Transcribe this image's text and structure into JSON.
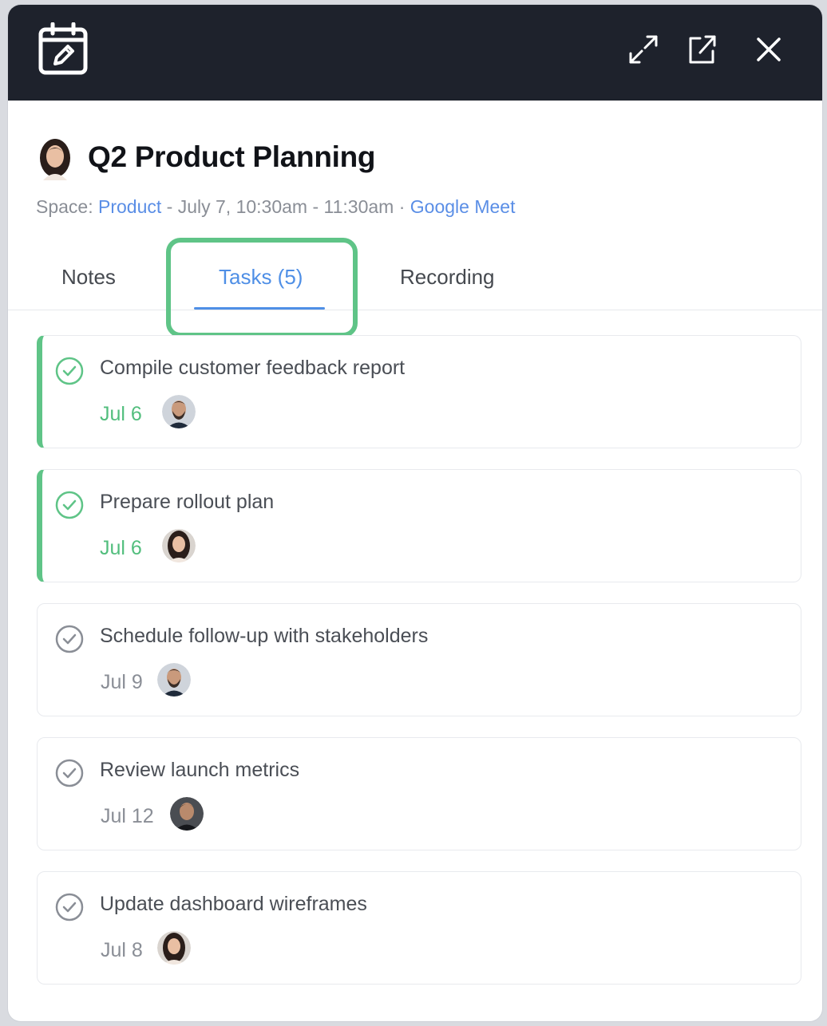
{
  "window": {
    "title": "Q2 Product Planning",
    "icons": {
      "app": "calendar-edit-icon",
      "expand": "expand-icon",
      "open": "open-external-icon",
      "close": "close-icon"
    }
  },
  "meta": {
    "space_label": "Space: ",
    "space_name": "Product",
    "time_text": " - July 7, 10:30am - 11:30am · ",
    "location": "Google Meet"
  },
  "tabs": [
    {
      "label": "Notes",
      "active": false
    },
    {
      "label": "Tasks (5)",
      "active": true
    },
    {
      "label": "Recording",
      "active": false
    }
  ],
  "tasks": [
    {
      "title": "Compile customer feedback report",
      "date": "Jul 6",
      "completed": true,
      "assignee": "man-beard"
    },
    {
      "title": "Prepare rollout plan",
      "date": "Jul 6",
      "completed": true,
      "assignee": "woman"
    },
    {
      "title": "Schedule follow-up with stakeholders",
      "date": "Jul 9",
      "completed": false,
      "assignee": "man-beard"
    },
    {
      "title": "Review launch metrics",
      "date": "Jul 12",
      "completed": false,
      "assignee": "man-dark"
    },
    {
      "title": "Update dashboard wireframes",
      "date": "Jul 8",
      "completed": false,
      "assignee": "woman"
    }
  ],
  "colors": {
    "titlebar": "#1e222c",
    "accent_blue": "#4f8fe6",
    "accent_green": "#5fc487",
    "date_done": "#52be7d"
  }
}
